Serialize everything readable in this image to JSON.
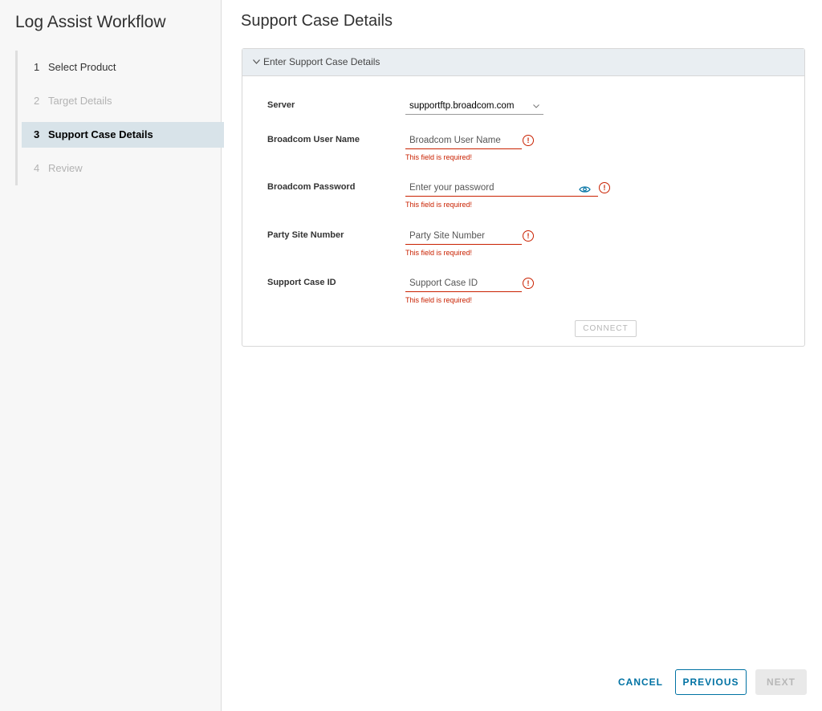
{
  "sidebar": {
    "title": "Log Assist Workflow",
    "steps": [
      {
        "num": "1",
        "label": "Select Product",
        "state": "done"
      },
      {
        "num": "2",
        "label": "Target Details",
        "state": "disabled"
      },
      {
        "num": "3",
        "label": "Support Case Details",
        "state": "active"
      },
      {
        "num": "4",
        "label": "Review",
        "state": "disabled"
      }
    ]
  },
  "main": {
    "title": "Support Case Details",
    "section": {
      "header": "Enter Support Case Details",
      "server": {
        "label": "Server",
        "value": "supportftp.broadcom.com"
      },
      "username": {
        "label": "Broadcom User Name",
        "placeholder": "Broadcom User Name",
        "error": "This field is required!"
      },
      "password": {
        "label": "Broadcom Password",
        "placeholder": "Enter your password",
        "error": "This field is required!"
      },
      "party_site": {
        "label": "Party Site Number",
        "placeholder": "Party Site Number",
        "error": "This field is required!"
      },
      "case_id": {
        "label": "Support Case ID",
        "placeholder": "Support Case ID",
        "error": "This field is required!"
      },
      "connect_label": "CONNECT"
    }
  },
  "footer": {
    "cancel": "CANCEL",
    "previous": "PREVIOUS",
    "next": "NEXT"
  },
  "colors": {
    "accent": "#0072a3",
    "error": "#c92100",
    "active_step_bg": "#d8e3e9"
  }
}
